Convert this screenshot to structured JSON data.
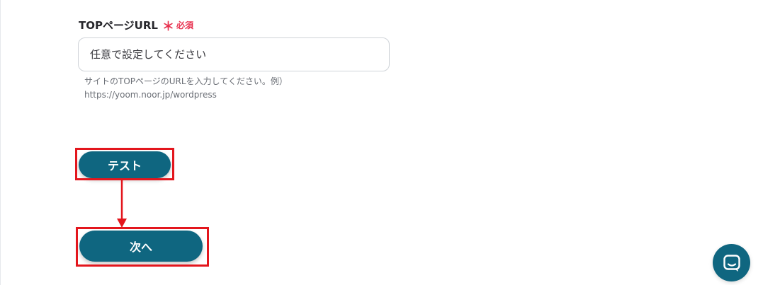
{
  "form": {
    "top_url_label": "TOPページURL",
    "required_mark": "＊",
    "required_text": "必須",
    "top_url_placeholder": "任意で設定してください",
    "top_url_help_line1": "サイトのTOPページのURLを入力してください。例）",
    "top_url_help_line2": "https://yoom.noor.jp/wordpress"
  },
  "actions": {
    "test_label": "テスト",
    "next_label": "次へ"
  },
  "icons": {
    "chat_launcher": "chat-bubble-icon",
    "flow_arrow": "arrow-down-icon"
  },
  "colors": {
    "primary": "#0f6680",
    "required": "#e8314f",
    "highlight": "#e3161d"
  }
}
